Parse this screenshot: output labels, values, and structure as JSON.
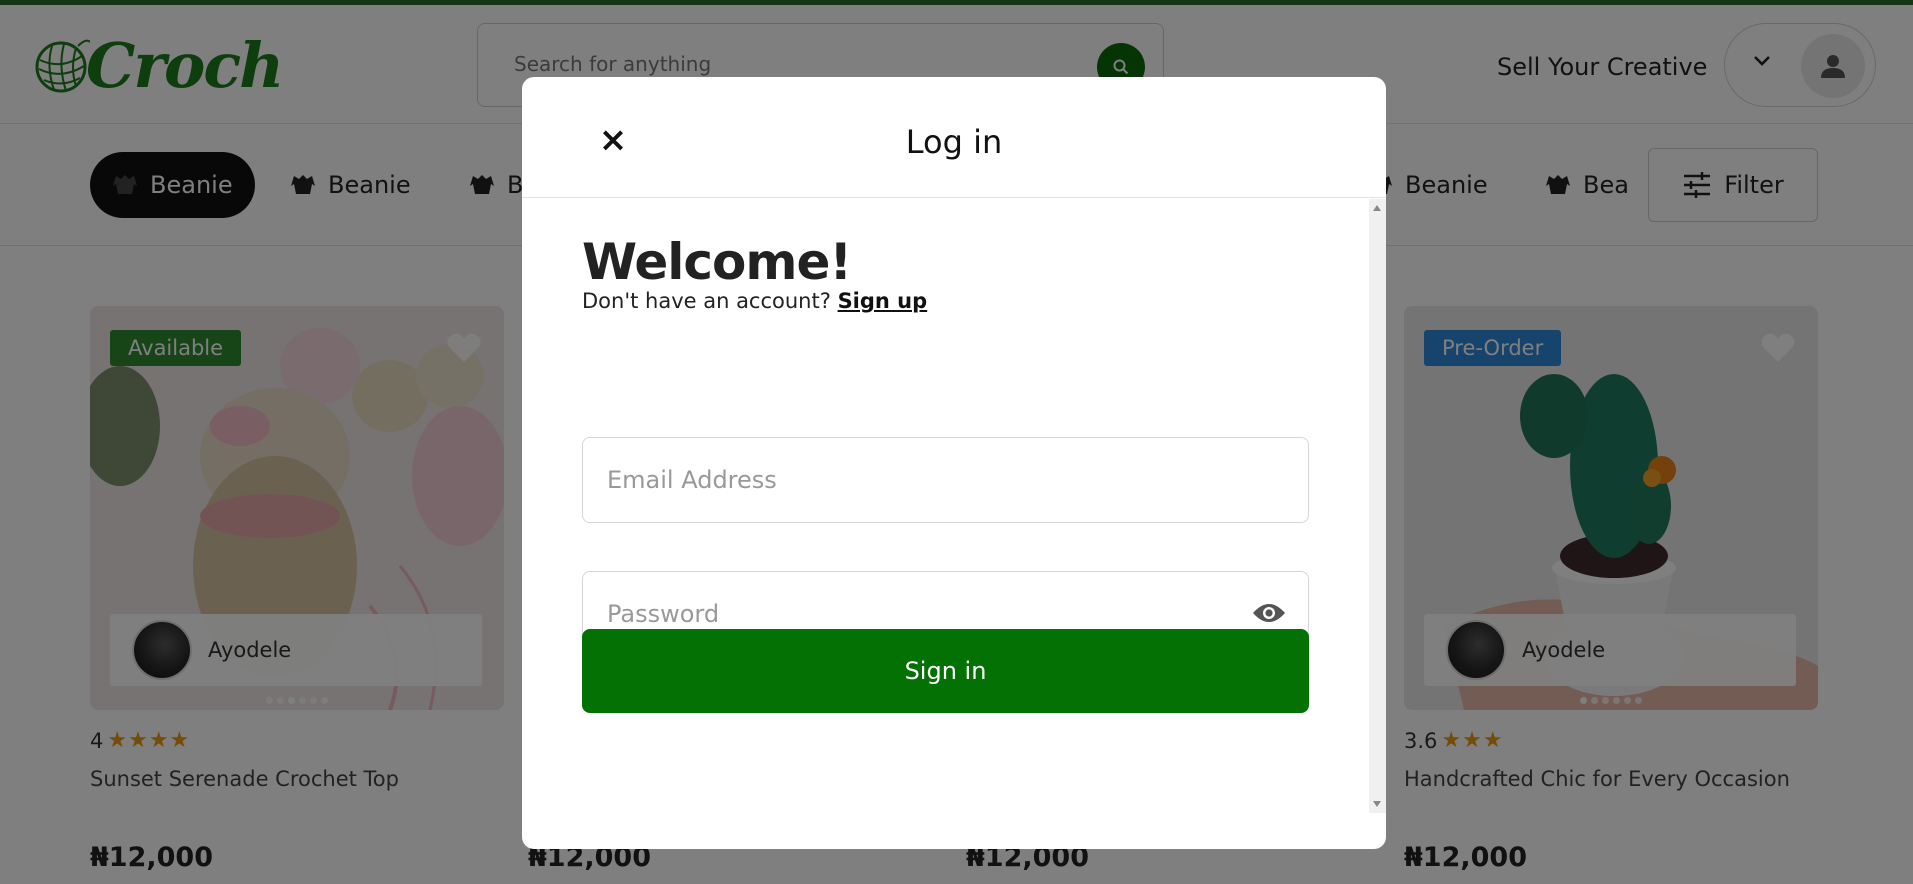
{
  "header": {
    "logo_text": "Croch",
    "search_placeholder": "Search for anything",
    "sell_link": "Sell Your Creative"
  },
  "categories": [
    {
      "label": "Beanie",
      "active": true
    },
    {
      "label": "Beanie",
      "active": false
    },
    {
      "label": "B",
      "active": false
    },
    {
      "label": "Beanie",
      "active": false
    },
    {
      "label": "Bea",
      "active": false
    }
  ],
  "filter_label": "Filter",
  "products": [
    {
      "badge": "Available",
      "seller": "Ayodele",
      "rating": "4",
      "stars": "★★★★",
      "title": "Sunset Serenade Crochet Top",
      "price": "₦12,000"
    },
    {
      "price": "₦12,000"
    },
    {
      "price": "₦12,000"
    },
    {
      "badge": "Pre-Order",
      "seller": "Ayodele",
      "rating": "3.6",
      "stars": "★★★",
      "title": "Handcrafted Chic for Every Occasion",
      "price": "₦12,000"
    }
  ],
  "modal": {
    "close_symbol": "×",
    "title": "Log in",
    "welcome": "Welcome!",
    "no_account_text": "Don't have an account?",
    "signup_link": "Sign up",
    "email_placeholder": "Email Address",
    "password_placeholder": "Password",
    "signin_label": "Sign in"
  },
  "colors": {
    "brand_green": "#037103",
    "accent_available": "#2e8b2e",
    "accent_preorder": "#2f88d8",
    "star": "#e89a12"
  }
}
